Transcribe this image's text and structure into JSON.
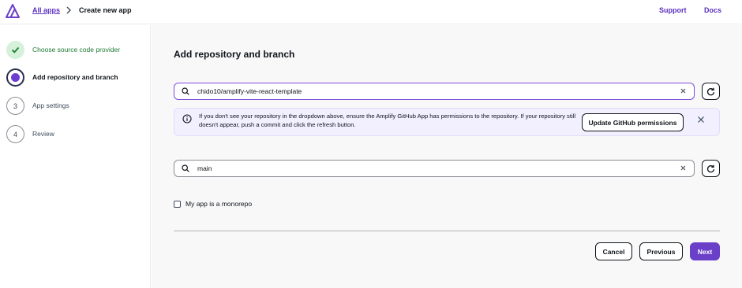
{
  "header": {
    "breadcrumb_link": "All apps",
    "breadcrumb_current": "Create new app",
    "support": "Support",
    "docs": "Docs"
  },
  "sidebar": {
    "steps": [
      {
        "number": "1",
        "label": "Choose source code provider",
        "status": "complete"
      },
      {
        "number": "2",
        "label": "Add repository and branch",
        "status": "current"
      },
      {
        "number": "3",
        "label": "App settings",
        "status": "pending"
      },
      {
        "number": "4",
        "label": "Review",
        "status": "pending"
      }
    ]
  },
  "main": {
    "heading": "Add repository and branch",
    "repository_value": "chido10/amplify-vite-react-template",
    "info_text": "If you don't see your repository in the dropdown above, ensure the Amplify GitHub App has permissions to the repository. If your repository still doesn't appear, push a commit and click the refresh button.",
    "update_permissions_label": "Update GitHub permissions",
    "branch_value": "main",
    "monorepo_label": "My app is a monorepo",
    "monorepo_checked": false
  },
  "footer": {
    "cancel": "Cancel",
    "previous": "Previous",
    "next": "Next"
  },
  "colors": {
    "accent": "#6b40c8",
    "link": "#5b2ec0",
    "success": "#1d7a33",
    "info_bg": "#f2f0ff"
  },
  "icons": [
    "amplify-logo-icon",
    "chevron-right-icon",
    "check-icon",
    "search-icon",
    "clear-icon",
    "refresh-icon",
    "info-icon",
    "close-icon"
  ]
}
